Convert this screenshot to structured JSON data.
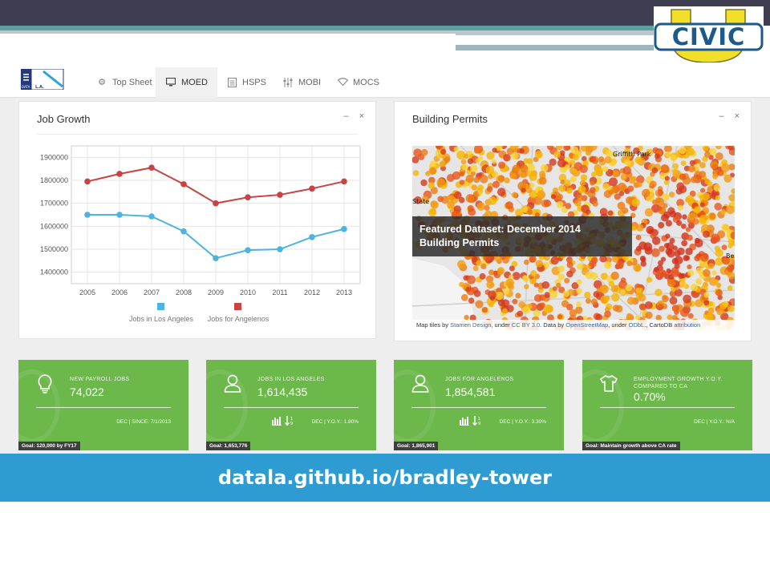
{
  "slide": {
    "url_banner": "datala.github.io/bradley-tower",
    "logo_text": "CIVIC",
    "logo_letter": "U",
    "colors": {
      "topbar": "#3e3e50",
      "teal": "#5f9ea0",
      "banner": "#2f9bd3",
      "tile": "#6cb84b"
    }
  },
  "navbar": {
    "brand_top": "DATA",
    "brand_bottom": "L.A.",
    "items": [
      {
        "label": "Top Sheet",
        "icon": "gear-icon"
      },
      {
        "label": "MOED",
        "icon": "monitor-icon"
      },
      {
        "label": "HSPS",
        "icon": "document-icon"
      },
      {
        "label": "MOBI",
        "icon": "sliders-icon"
      },
      {
        "label": "MOCS",
        "icon": "wifi-icon"
      }
    ],
    "active": "MOED"
  },
  "job_growth": {
    "title": "Job Growth",
    "minimize": "–",
    "close": "×",
    "chart_data": {
      "type": "line",
      "x": [
        "2005",
        "2006",
        "2007",
        "2008",
        "2009",
        "2010",
        "2011",
        "2012",
        "2013"
      ],
      "y_ticks": [
        "1900000",
        "1800000",
        "1700000",
        "1600000",
        "1500000",
        "1400000"
      ],
      "ylim": [
        1350000,
        1950000
      ],
      "series": [
        {
          "name": "Jobs in Los Angeles",
          "color": "#4db3e0",
          "values": [
            1650000,
            1650000,
            1643000,
            1578000,
            1461000,
            1496000,
            1500000,
            1553000,
            1588000
          ]
        },
        {
          "name": "Jobs for Angelenos",
          "color": "#c84444",
          "values": [
            1795000,
            1828000,
            1855000,
            1783000,
            1700000,
            1726000,
            1737000,
            1764000,
            1795000
          ]
        }
      ],
      "grid": true,
      "legend": "bottom"
    }
  },
  "building_permits": {
    "title": "Building Permits",
    "minimize": "–",
    "close": "×",
    "place_labels": [
      "Griffith Park",
      "State",
      "Be"
    ],
    "banner_line1": "Featured Dataset: December 2014",
    "banner_line2": "Building Permits",
    "attribution": {
      "p1": "Map tiles by ",
      "stamen": "Stamen Design",
      "p2": ", under ",
      "ccby": "CC BY 3.0",
      "p3": ". Data by ",
      "osm": "OpenStreetMap",
      "p4": ", under ",
      "odbl": "ODbL",
      "p5": "., CartoDB ",
      "attr": "attribution"
    }
  },
  "tiles": [
    {
      "label": "NEW PAYROLL JOBS",
      "value": "74,022",
      "meta": "DEC | SINCE: 7/1/2013",
      "goal": "Goal: 120,000 by FY17",
      "icon": "lightbulb-icon",
      "has_meta_icons": false
    },
    {
      "label": "JOBS IN LOS ANGELES",
      "value": "1,614,435",
      "meta": "DEC | Y.O.Y.: 1.80%",
      "goal": "Goal: 1,653,776",
      "icon": "person-icon",
      "has_meta_icons": true
    },
    {
      "label": "JOBS FOR ANGELENOS",
      "value": "1,854,581",
      "meta": "DEC | Y.O.Y.: 3.30%",
      "goal": "Goal: 1,865,901",
      "icon": "person-icon",
      "has_meta_icons": true
    },
    {
      "label": "EMPLOYMENT GROWTH Y.O.Y. COMPARED TO CA",
      "value": "0.70%",
      "meta": "DEC | Y.O.Y.: N/A",
      "goal": "Goal: Maintain growth above CA rate",
      "icon": "shirt-icon",
      "has_meta_icons": false
    }
  ]
}
